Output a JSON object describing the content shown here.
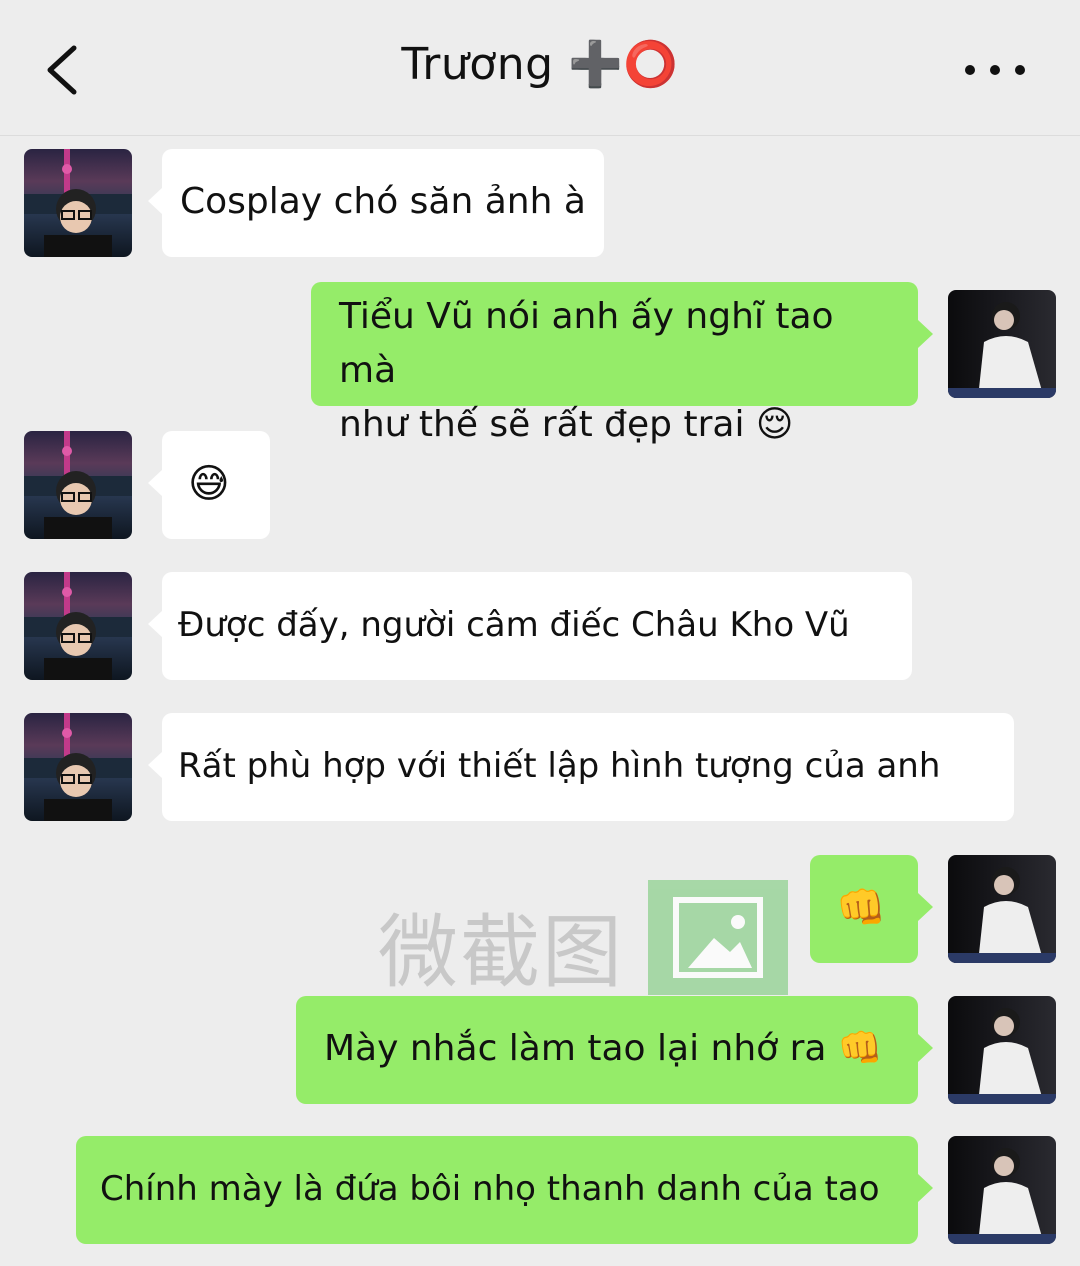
{
  "header": {
    "title": "Trương",
    "title_emoji": "➕⭕",
    "back_icon": "chevron-left-icon",
    "more_icon": "more-horizontal-icon"
  },
  "messages": [
    {
      "side": "them",
      "text": "Cosplay chó săn ảnh à"
    },
    {
      "side": "me",
      "text": "Tiểu Vũ nói anh ấy nghĩ tao mà\nnhư thế sẽ rất đẹp trai 😌"
    },
    {
      "side": "them",
      "text": "😅"
    },
    {
      "side": "them",
      "text": "Được đấy, người câm điếc Châu Kho Vũ"
    },
    {
      "side": "them",
      "text": "Rất phù hợp với thiết lập hình tượng của anh"
    },
    {
      "side": "me",
      "text": "👊"
    },
    {
      "side": "me",
      "text": "Mày nhắc làm tao lại nhớ ra 👊"
    },
    {
      "side": "me",
      "text": "Chính mày là đứa bôi nhọ thanh danh của tao"
    }
  ],
  "watermark": {
    "text": "微截图"
  },
  "colors": {
    "background": "#ededed",
    "my_bubble": "#95ec69",
    "their_bubble": "#ffffff"
  }
}
